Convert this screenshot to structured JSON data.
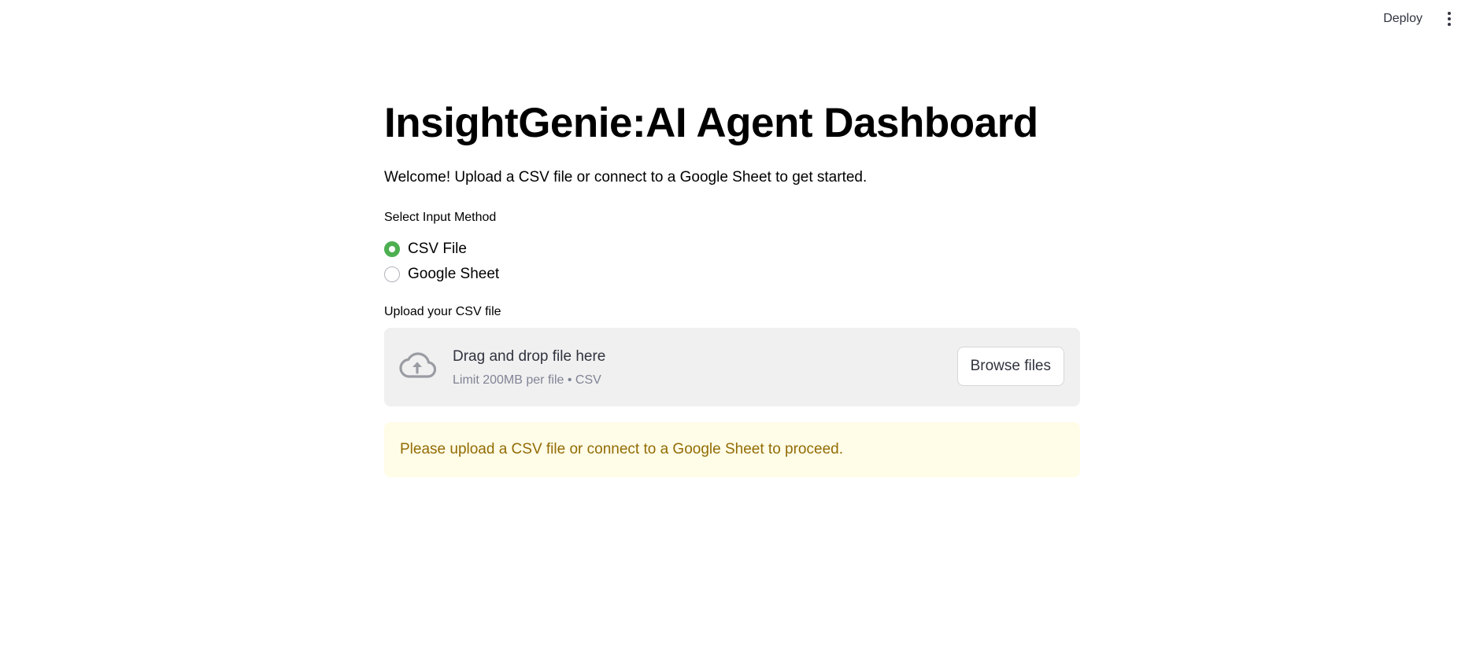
{
  "header": {
    "deploy_label": "Deploy",
    "menu_icon": "kebab-menu-icon"
  },
  "main": {
    "title": "InsightGenie:AI Agent Dashboard",
    "welcome": "Welcome! Upload a CSV file or connect to a Google Sheet to get started.",
    "input_method": {
      "label": "Select Input Method",
      "options": [
        {
          "label": "CSV File",
          "selected": true
        },
        {
          "label": "Google Sheet",
          "selected": false
        }
      ]
    },
    "uploader": {
      "label": "Upload your CSV file",
      "icon": "cloud-upload-icon",
      "title": "Drag and drop file here",
      "subtitle": "Limit 200MB per file • CSV",
      "browse_label": "Browse files"
    },
    "warning": "Please upload a CSV file or connect to a Google Sheet to proceed."
  },
  "colors": {
    "accent": "#4caf50",
    "warning_bg": "#fffce7",
    "warning_text": "#926c05",
    "dropzone_bg": "#f0f0f0"
  }
}
